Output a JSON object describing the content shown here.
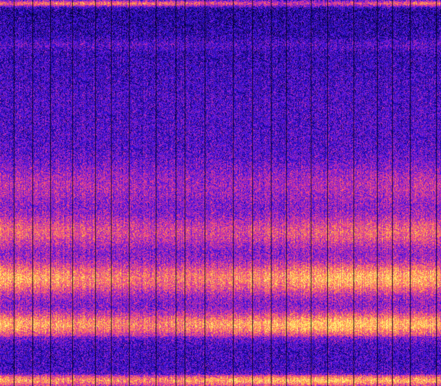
{
  "image": {
    "description_kind": "spectrogram-waterfall",
    "colormap": [
      "#000010",
      "#10056a",
      "#2a10d8",
      "#7a1ce0",
      "#d1309e",
      "#ff5a74",
      "#ffb040",
      "#fff07a"
    ],
    "bands": [
      {
        "center": 0.008,
        "width": 0.006,
        "strength": 0.95
      },
      {
        "center": 0.115,
        "width": 0.01,
        "strength": 0.18
      },
      {
        "center": 0.48,
        "width": 0.04,
        "strength": 0.35
      },
      {
        "center": 0.6,
        "width": 0.03,
        "strength": 0.6
      },
      {
        "center": 0.72,
        "width": 0.03,
        "strength": 0.9
      },
      {
        "center": 0.84,
        "width": 0.022,
        "strength": 0.95
      },
      {
        "center": 0.985,
        "width": 0.01,
        "strength": 0.9
      }
    ],
    "vertical_dark_lines": 22
  }
}
